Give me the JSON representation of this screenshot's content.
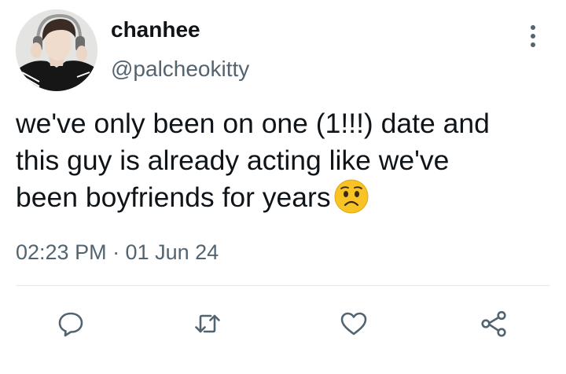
{
  "user": {
    "display_name": "chanhee",
    "handle": "@palcheokitty"
  },
  "tweet": {
    "lines": [
      "we've only been on one (1!!!) date and",
      "this guy is already acting like we've",
      "been boyfriends for years"
    ],
    "emoji": "worried-face-emoji",
    "timestamp": "02:23 PM · 01 Jun 24"
  },
  "actions": [
    "reply-icon",
    "retweet-icon",
    "like-icon",
    "share-icon"
  ],
  "colors": {
    "text": "#0f1419",
    "secondary": "#536471",
    "divider": "#e6e9eb",
    "emoji_face": "#f7c325"
  }
}
